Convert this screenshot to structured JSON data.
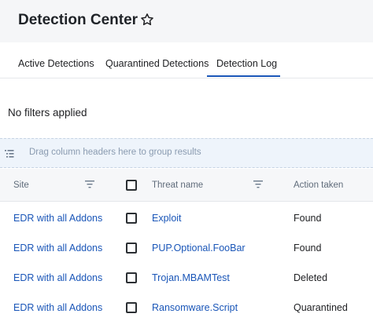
{
  "header": {
    "title": "Detection Center"
  },
  "tabs": [
    {
      "label": "Active Detections"
    },
    {
      "label": "Quarantined Detections"
    },
    {
      "label": "Detection Log"
    }
  ],
  "active_tab": "Detection Log",
  "filters": {
    "status": "No filters applied"
  },
  "group_bar": {
    "text": "Drag column headers here to group results"
  },
  "table": {
    "columns": {
      "site": "Site",
      "threat_name": "Threat name",
      "action_taken": "Action taken"
    },
    "rows": [
      {
        "site": "EDR with all Addons",
        "threat": "Exploit",
        "action": "Found"
      },
      {
        "site": "EDR with all Addons",
        "threat": "PUP.Optional.FooBar",
        "action": "Found"
      },
      {
        "site": "EDR with all Addons",
        "threat": "Trojan.MBAMTest",
        "action": "Deleted"
      },
      {
        "site": "EDR with all Addons",
        "threat": "Ransomware.Script",
        "action": "Quarantined"
      }
    ]
  },
  "colors": {
    "accent": "#1a56b8",
    "header_bg": "#f5f6f8",
    "group_bar_bg": "#eef4fb"
  }
}
